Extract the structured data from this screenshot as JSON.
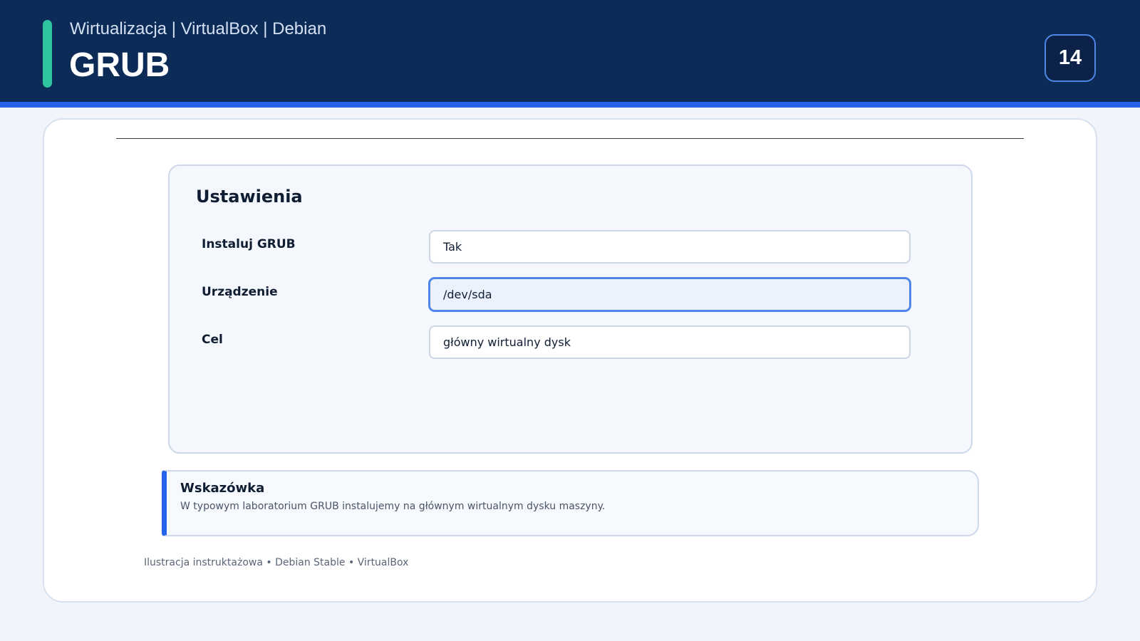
{
  "header": {
    "subtitle": "Wirtualizacja | VirtualBox | Debian",
    "title": "GRUB",
    "page_number": "14"
  },
  "settings": {
    "title": "Ustawienia",
    "fields": [
      {
        "label": "Instaluj GRUB",
        "value": "Tak",
        "focused": false
      },
      {
        "label": "Urządzenie",
        "value": "/dev/sda",
        "focused": true
      },
      {
        "label": "Cel",
        "value": "główny wirtualny dysk",
        "focused": false
      }
    ]
  },
  "hint": {
    "title": "Wskazówka",
    "text": "W typowym laboratorium GRUB instalujemy na głównym wirtualnym dysku maszyny."
  },
  "footer": {
    "note": "Ilustracja instruktażowa • Debian Stable • VirtualBox"
  },
  "colors": {
    "header_bg": "#0c2b56",
    "accent_teal": "#2ec4a0",
    "accent_blue": "#2563eb",
    "focus_border": "#4f86e8"
  }
}
